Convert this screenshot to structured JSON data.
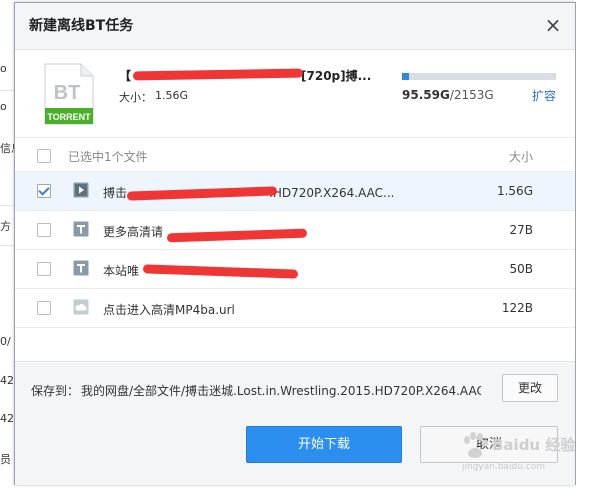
{
  "background_fragments": [
    "o",
    "o",
    "信息",
    "方",
    "0/",
    "42",
    "42",
    "员"
  ],
  "dialog": {
    "title": "新建离线BT任务",
    "close_glyph": "×"
  },
  "torrent": {
    "icon_text": "BT",
    "icon_label": "TORRENT",
    "task_name_prefix": "【",
    "task_name_suffix": "[720p]搏...",
    "size_label": "大小：",
    "size_value": "1.56G"
  },
  "space": {
    "used": "95.59G",
    "total": "/2153G",
    "used_fraction": 0.0444,
    "expand_label": "扩容"
  },
  "file_list": {
    "selected_label": "已选中1个文件",
    "size_header": "大小",
    "rows": [
      {
        "name_prefix": "搏击",
        "name_suffix": ".HD720P.X264.AAC...",
        "size": "1.56G",
        "checked": true,
        "type": "video"
      },
      {
        "name_prefix": "更多高清请",
        "name_suffix": "",
        "size": "27B",
        "checked": false,
        "type": "text"
      },
      {
        "name_prefix": "本站唯",
        "name_suffix": "",
        "size": "50B",
        "checked": false,
        "type": "text"
      },
      {
        "name_prefix": "点击进入高清MP4ba.url",
        "name_suffix": "",
        "size": "122B",
        "checked": false,
        "type": "url"
      }
    ]
  },
  "footer": {
    "save_label": "保存到：",
    "save_path": "我的网盘/全部文件/搏击迷城.Lost.in.Wrestling.2015.HD720P.X264.AAC...",
    "change_label": "更改",
    "start_label": "开始下载",
    "cancel_label": "取消"
  },
  "watermark": {
    "text": "Baidu 经验",
    "sub": "jingyan.baidu.com"
  },
  "colors": {
    "accent": "#2c8ff0",
    "link": "#2c72c7",
    "redaction": "#ef2a2a",
    "icon_green": "#4caf2a"
  }
}
